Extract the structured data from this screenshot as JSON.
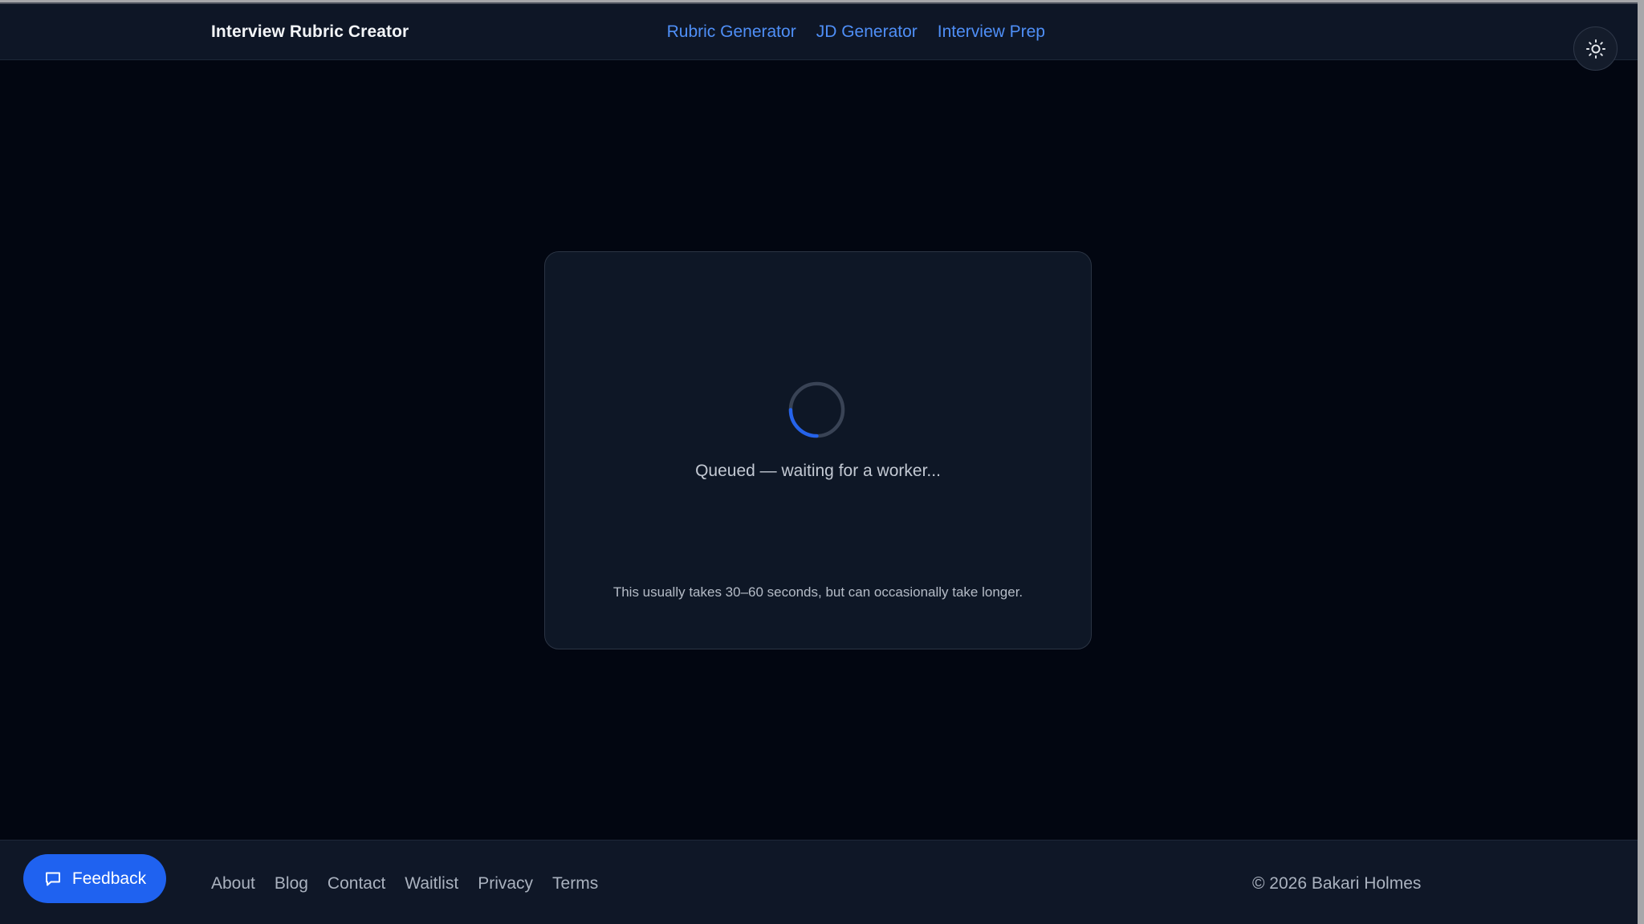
{
  "header": {
    "brand": "Interview Rubric Creator",
    "nav": [
      {
        "label": "Rubric Generator"
      },
      {
        "label": "JD Generator"
      },
      {
        "label": "Interview Prep"
      }
    ],
    "theme_toggle_icon": "sun-icon"
  },
  "main": {
    "status_text": "Queued — waiting for a worker...",
    "hint_text": "This usually takes 30–60 seconds, but can occasionally take longer.",
    "spinner_icon": "loading-spinner-icon"
  },
  "footer": {
    "feedback_label": "Feedback",
    "feedback_icon": "message-icon",
    "links": [
      {
        "label": "About"
      },
      {
        "label": "Blog"
      },
      {
        "label": "Contact"
      },
      {
        "label": "Waitlist"
      },
      {
        "label": "Privacy"
      },
      {
        "label": "Terms"
      }
    ],
    "copyright": "© 2026 Bakari Holmes"
  },
  "colors": {
    "background": "#020611",
    "surface": "#0e1726",
    "accent": "#1f62f0",
    "link": "#4f8ff7"
  }
}
